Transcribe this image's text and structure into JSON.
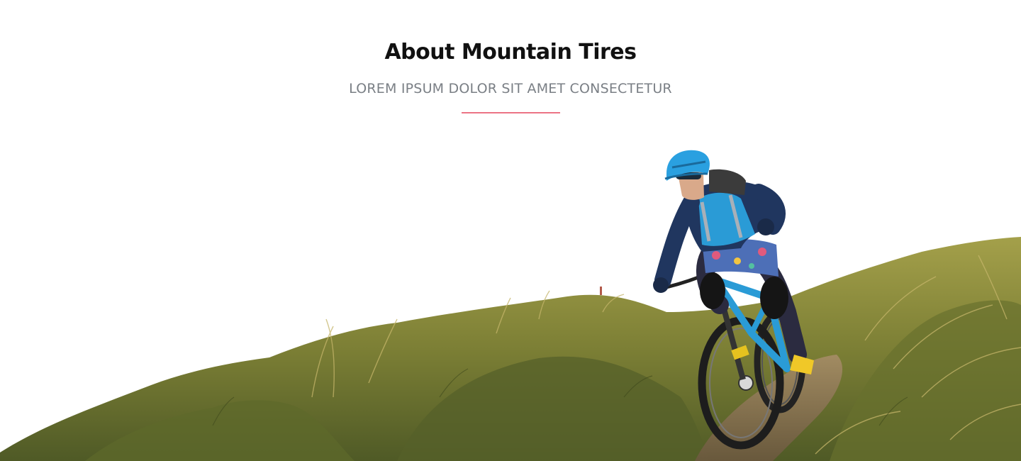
{
  "section": {
    "title": "About Mountain Tires",
    "subtitle": "LOREM IPSUM DOLOR SIT AMET CONSECTETUR"
  },
  "colors": {
    "title": "#111111",
    "subtitle": "#7a7f85",
    "divider_accent": "#ec7385",
    "background": "#ffffff",
    "grass": "#8d8f3c",
    "rider_blue": "#2a9bd6"
  },
  "image": {
    "subject": "mountain-biker-on-grassy-hillside"
  }
}
